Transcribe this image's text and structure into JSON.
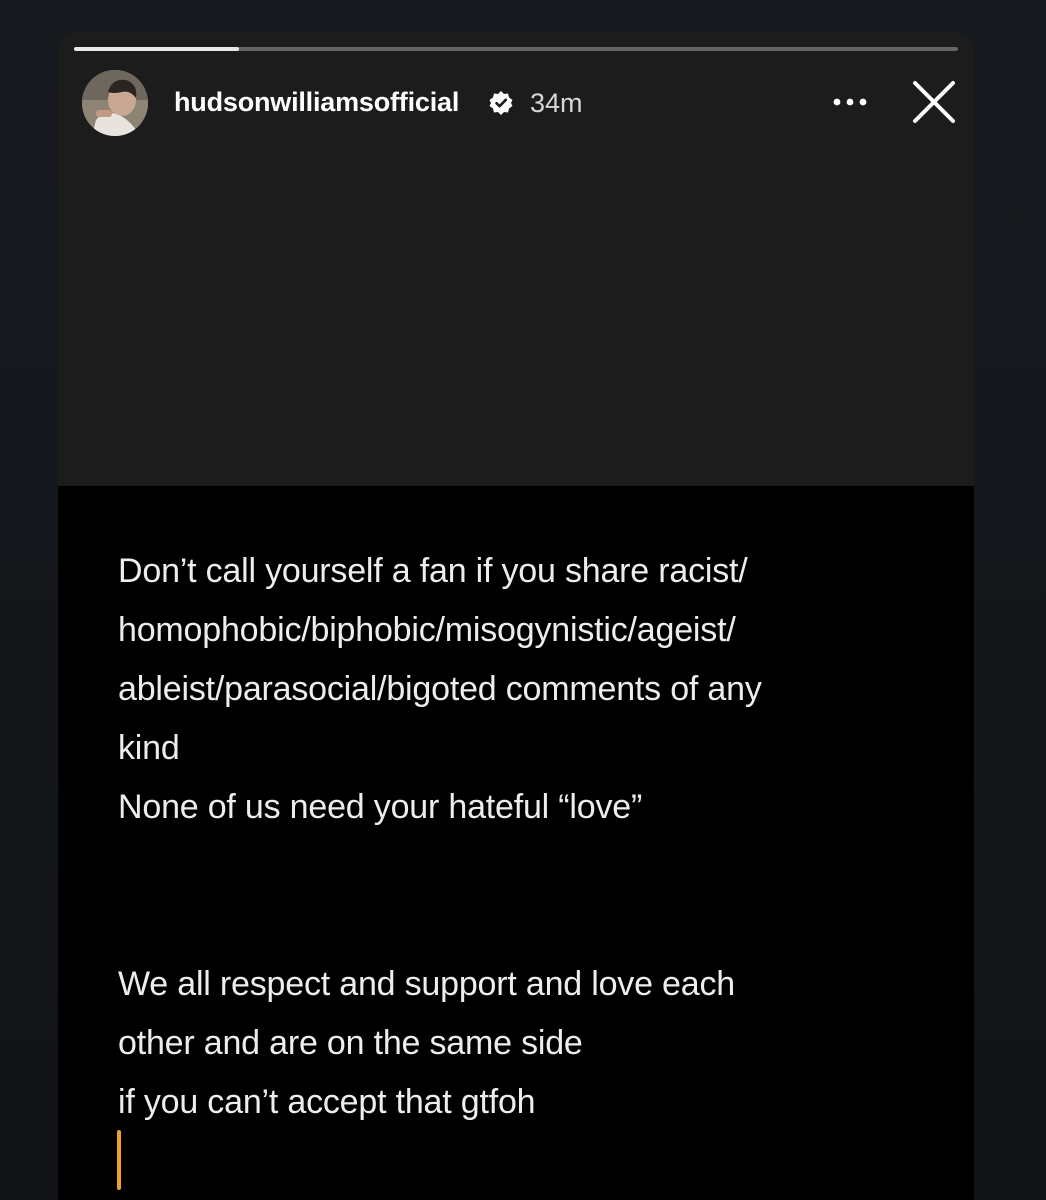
{
  "story": {
    "progress": 0.187,
    "username": "hudsonwilliamsofficial",
    "verified": true,
    "timestamp": "34m",
    "avatar_icon": "profile-photo",
    "more_icon": "more-horizontal-icon",
    "close_icon": "close-icon"
  },
  "text": {
    "paragraph1": [
      "Don’t call yourself a fan if you share racist/",
      "homophobic/biphobic/misogynistic/ageist/",
      "ableist/parasocial/bigoted comments of any",
      "kind",
      "None of us need your hateful “love”"
    ],
    "paragraph2": [
      "We all respect and support and love each",
      "other and are on the same side",
      "if you can’t accept that gtfoh"
    ]
  },
  "colors": {
    "background": "#16191e",
    "story_upper": "#1c1c1d",
    "story_lower": "#000000",
    "text": "#ededed",
    "cursor": "#f0a02a"
  }
}
